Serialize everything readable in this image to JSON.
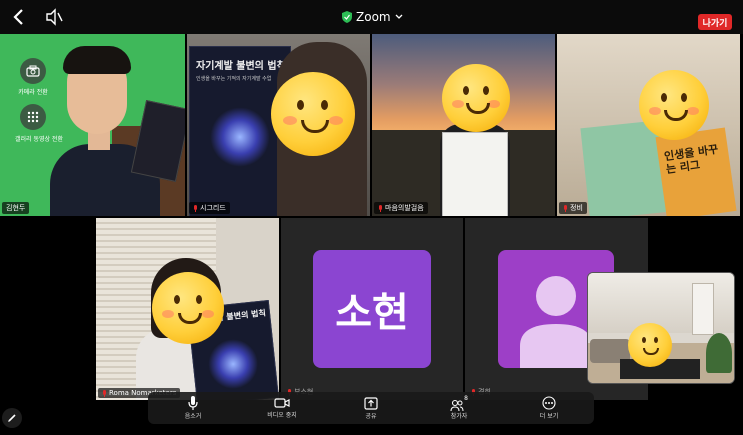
{
  "header": {
    "title": "Zoom",
    "leave_label": "나가기"
  },
  "tiles": {
    "t1": {
      "name": "김현두",
      "switch_camera_label": "카메라 전환",
      "gallery_label": "갤러리 동영상 전환"
    },
    "t2": {
      "name": "시그리드",
      "book_title": "자기계발 불변의 법칙",
      "book_subtitle": "인생을 바꾸는 기적의 자기계발 수업"
    },
    "t3": {
      "name": "마음의발걸음"
    },
    "t4": {
      "name": "정비",
      "book_text": "인생을 바꾸는 리그"
    },
    "t5": {
      "name": "Roma Nomarketers",
      "book_title": "자기계발 불변의 법칙"
    },
    "t6": {
      "avatar_text": "소현",
      "name": "부소현"
    },
    "t7": {
      "name": "경희"
    }
  },
  "toolbar": {
    "mute_label": "음소거",
    "video_label": "비디오 중지",
    "share_label": "공유",
    "participants_label": "참가자",
    "participants_count": "8",
    "more_label": "더 보기"
  },
  "colors": {
    "leave": "#e02828",
    "avatar_soheon": "#8b45d1",
    "avatar_placeholder": "#9d3fc7",
    "secure_shield": "#2dbd55"
  }
}
